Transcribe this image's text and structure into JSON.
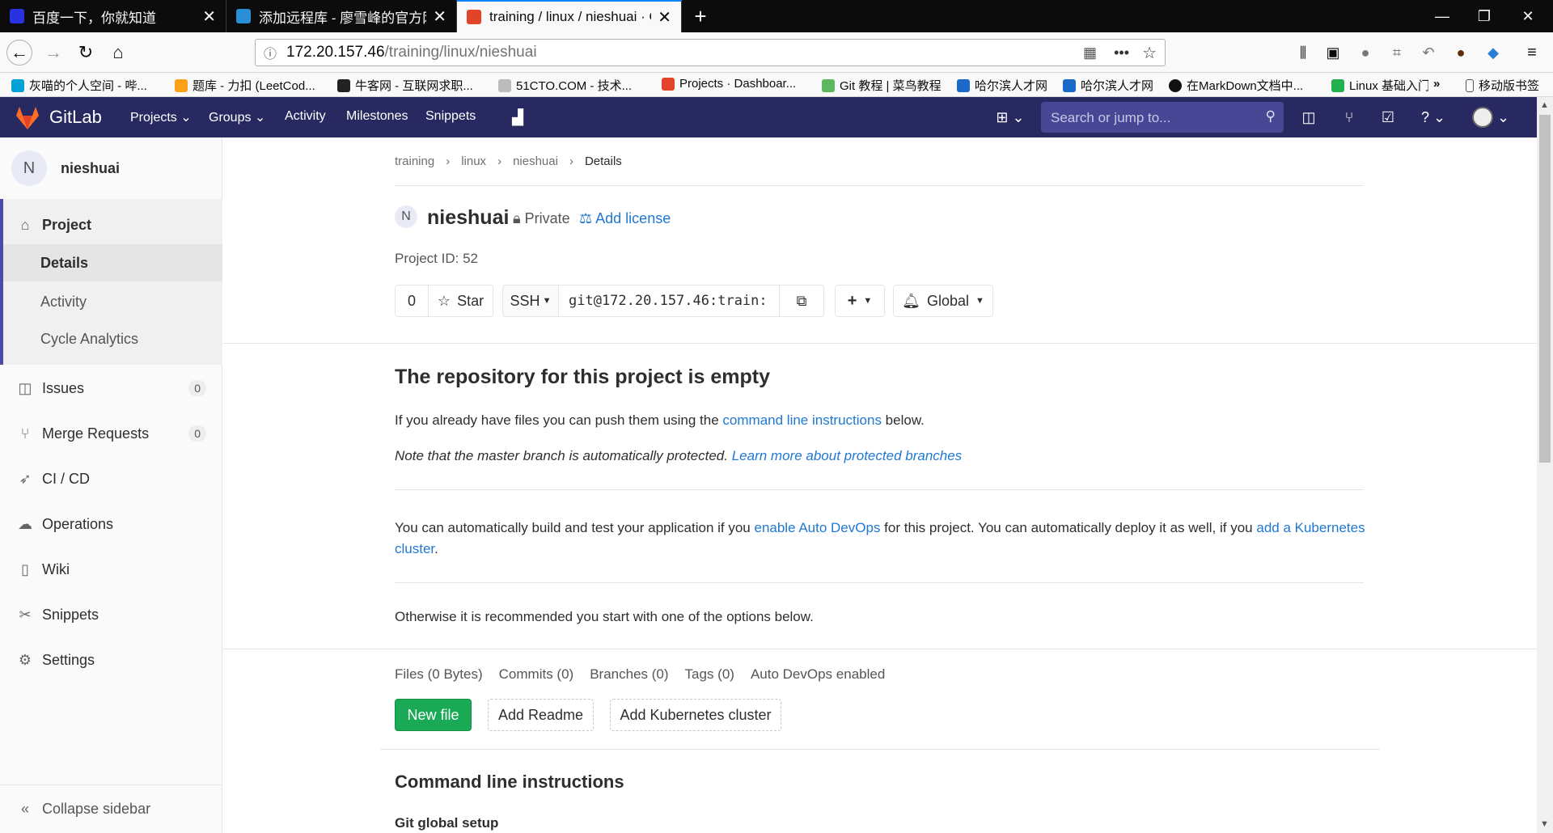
{
  "browser": {
    "tabs": [
      {
        "title": "百度一下，你就知道"
      },
      {
        "title": "添加远程库 - 廖雪峰的官方网站"
      },
      {
        "title": "training / linux / nieshuai · GitLab"
      }
    ],
    "url_host": "172.20.157.46",
    "url_path": "/training/linux/nieshuai",
    "bookmarks": [
      "灰喵的个人空间 - 哔...",
      "题库 - 力扣 (LeetCod...",
      "牛客网 - 互联网求职...",
      "51CTO.COM - 技术...",
      "Projects · Dashboar...",
      "Git 教程 | 菜鸟教程",
      "哈尔滨人才网",
      "哈尔滨人才网",
      "在MarkDown文档中...",
      "Linux 基础入门",
      "移动版书签"
    ]
  },
  "gitlab": {
    "brand": "GitLab",
    "nav": [
      "Projects",
      "Groups",
      "Activity",
      "Milestones",
      "Snippets"
    ],
    "search_placeholder": "Search or jump to..."
  },
  "sidebar": {
    "avatar_letter": "N",
    "project_name": "nieshuai",
    "project_label": "Project",
    "sub_items": [
      "Details",
      "Activity",
      "Cycle Analytics"
    ],
    "items": [
      {
        "label": "Issues",
        "count": "0"
      },
      {
        "label": "Merge Requests",
        "count": "0"
      },
      {
        "label": "CI / CD"
      },
      {
        "label": "Operations"
      },
      {
        "label": "Wiki"
      },
      {
        "label": "Snippets"
      },
      {
        "label": "Settings"
      }
    ],
    "collapse": "Collapse sidebar"
  },
  "breadcrumb": [
    "training",
    "linux",
    "nieshuai",
    "Details"
  ],
  "project": {
    "avatar_letter": "N",
    "name": "nieshuai",
    "visibility": "Private",
    "add_license": "Add license",
    "id_label": "Project ID: 52",
    "star_count": "0",
    "star_label": "Star",
    "protocol": "SSH",
    "clone_url": "git@172.20.157.46:train:",
    "notification": "Global"
  },
  "empty": {
    "heading": "The repository for this project is empty",
    "p1_pre": "If you already have files you can push them using the ",
    "p1_link": "command line instructions",
    "p1_post": " below.",
    "p2_pre": "Note that the master branch is automatically protected. ",
    "p2_link": "Learn more about protected branches",
    "p3_pre": "You can automatically build and test your application if you ",
    "p3_link1": "enable Auto DevOps",
    "p3_mid": " for this project. You can automatically deploy it as well, if you ",
    "p3_link2": "add a Kubernetes cluster",
    "p3_post": ".",
    "p4": "Otherwise it is recommended you start with one of the options below."
  },
  "stats": [
    "Files (0 Bytes)",
    "Commits (0)",
    "Branches (0)",
    "Tags (0)",
    "Auto DevOps enabled"
  ],
  "actions": {
    "new_file": "New file",
    "add_readme": "Add Readme",
    "add_k8s": "Add Kubernetes cluster"
  },
  "cli": {
    "heading": "Command line instructions",
    "sub": "Git global setup"
  },
  "colors": {
    "header": "#292961",
    "link": "#1f78d1",
    "success": "#1aaa55"
  }
}
